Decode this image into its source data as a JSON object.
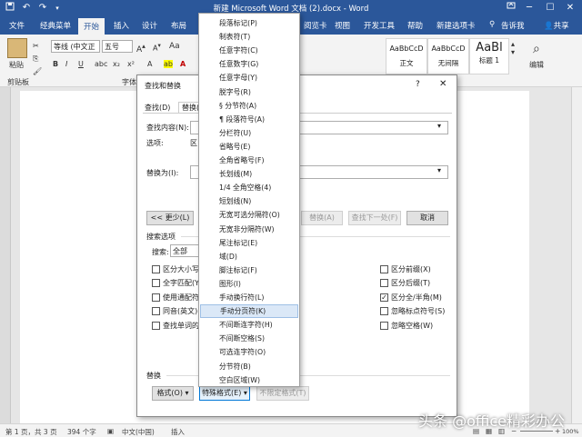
{
  "window": {
    "title": "新建 Microsoft Word 文档 (2).docx - Word",
    "controls": {
      "minimize": "─",
      "maximize": "☐",
      "close": "✕"
    }
  },
  "qat": {
    "save_icon": "save-icon",
    "undo_icon": "↶",
    "redo_icon": "↷"
  },
  "tabs": {
    "file": "文件",
    "classic": "经典菜单",
    "home": "开始",
    "insert": "插入",
    "design": "设计",
    "layout": "布局",
    "review": "阅览卡",
    "view": "视图",
    "dev": "开发工具",
    "help": "帮助",
    "newtab": "新建选项卡",
    "tellme": "告诉我",
    "share": "共享"
  },
  "ribbon": {
    "paste": "粘贴",
    "clipboard": "剪贴板",
    "font_name": "等线 (中文正",
    "font_size": "五号",
    "font_group": "字体",
    "styles": [
      {
        "preview": "AaBbCcD",
        "name": "正文"
      },
      {
        "preview": "AaBbCcD",
        "name": "无间隔"
      },
      {
        "preview": "AaBl",
        "name": "标题 1"
      }
    ],
    "editing": "编辑"
  },
  "dialog": {
    "title": "查找和替换",
    "help": "?",
    "close": "✕",
    "tabs": {
      "find": "查找(D)",
      "replace": "替换(P"
    },
    "find_label": "查找内容(N):",
    "options_label": "选项:",
    "options_value": "区",
    "replace_label": "替换为(I):",
    "less_button": "<< 更少(L)",
    "replace_all_button": "替换(A)",
    "find_next_button": "查找下一处(F)",
    "cancel_button": "取消",
    "search_options_title": "搜索选项",
    "search_label": "搜索:",
    "search_value": "全部",
    "checks_left": [
      {
        "label": "区分大小写",
        "checked": false
      },
      {
        "label": "全字匹配(Y",
        "checked": false
      },
      {
        "label": "使用通配符",
        "checked": false
      },
      {
        "label": "同音(英文)(",
        "checked": false
      },
      {
        "label": "查找单词的所",
        "checked": false
      }
    ],
    "checks_right": [
      {
        "label": "区分前缀(X)",
        "checked": false
      },
      {
        "label": "区分后缀(T)",
        "checked": false
      },
      {
        "label": "区分全/半角(M)",
        "checked": true
      },
      {
        "label": "忽略标点符号(S)",
        "checked": false
      },
      {
        "label": "忽略空格(W)",
        "checked": false
      }
    ],
    "replace_section": "替换",
    "format_button": "格式(O)",
    "special_button": "特殊格式(E)",
    "noformat_button": "不限定格式(T)",
    "check_mark": "✓",
    "dropdown_arrow": "▾"
  },
  "menu": {
    "items": [
      "段落标记(P)",
      "制表符(T)",
      "任意字符(C)",
      "任意数字(G)",
      "任意字母(Y)",
      "脱字号(R)",
      "§ 分节符(A)",
      "¶ 段落符号(A)",
      "分栏符(U)",
      "省略号(E)",
      "全角省略号(F)",
      "长划线(M)",
      "1/4 全角空格(4)",
      "短划线(N)",
      "无宽可选分隔符(O)",
      "无宽非分隔符(W)",
      "尾注标记(E)",
      "域(D)",
      "脚注标记(F)",
      "图形(I)",
      "手动换行符(L)",
      "手动分页符(K)",
      "不间断连字符(H)",
      "不间断空格(S)",
      "可选连字符(O)",
      "分节符(B)",
      "空白区域(W)"
    ],
    "highlighted_index": 21
  },
  "status": {
    "page": "第 1 页，共 3 页",
    "words": "394 个字",
    "lang": "中文(中国)",
    "insert": "插入",
    "zoom": "100%"
  },
  "watermark": "头条 @office精彩办公",
  "colors": {
    "accent": "#2b579a",
    "highlight": "#dbe8f7",
    "font_color": "#c00000"
  }
}
